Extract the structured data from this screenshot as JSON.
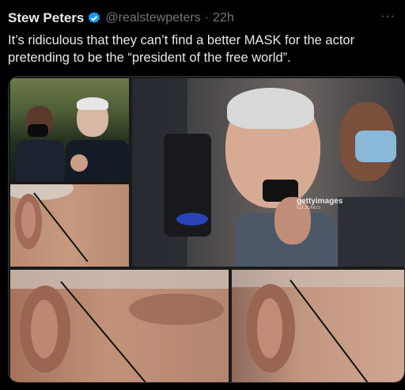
{
  "tweet": {
    "display_name": "Stew Peters",
    "handle": "@realstewpeters",
    "separator": "·",
    "timestamp": "22h",
    "more_label": "···",
    "text": "It’s ridiculous that they can’t find a better MASK for the actor pretending to be the “president of the free world”."
  },
  "media": {
    "watermark": "gettyimages",
    "watermark_sub": "ED JONES"
  },
  "icons": {
    "verified": "verified-badge-icon",
    "more": "more-options-icon"
  },
  "colors": {
    "background": "#000000",
    "text": "#e7e9ea",
    "secondary": "#71767b",
    "verified": "#1d9bf0"
  }
}
